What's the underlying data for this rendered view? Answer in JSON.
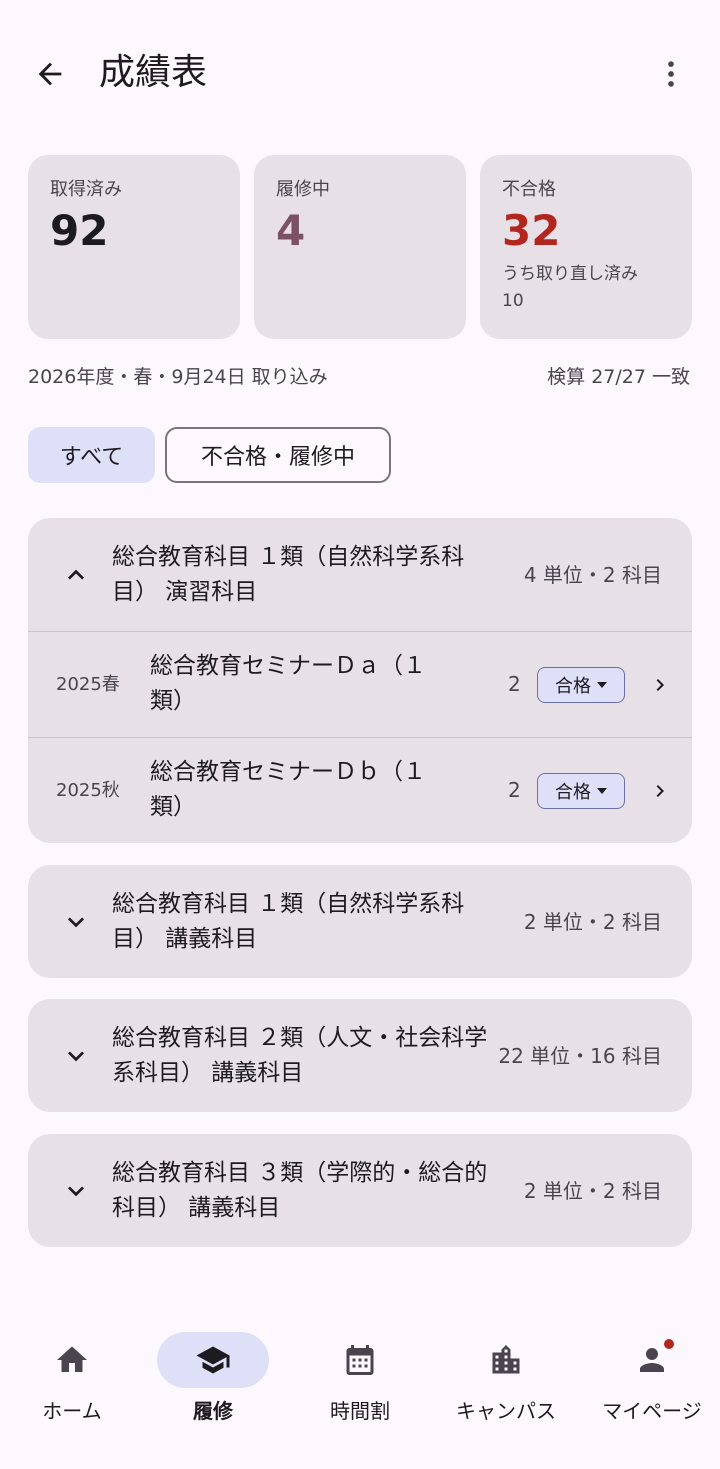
{
  "header": {
    "title": "成績表"
  },
  "summary": {
    "earned": {
      "label": "取得済み",
      "value": "92"
    },
    "in_progress": {
      "label": "履修中",
      "value": "4"
    },
    "failed": {
      "label": "不合格",
      "value": "32",
      "sub_label": "うち取り直し済み",
      "sub_value": "10"
    }
  },
  "meta": {
    "import_info": "2026年度・春・9月24日 取り込み",
    "check_info": "検算 27/27 一致"
  },
  "filters": [
    {
      "label": "すべて",
      "selected": true
    },
    {
      "label": "不合格・履修中",
      "selected": false
    }
  ],
  "groups": [
    {
      "title": "総合教育科目 １類（自然科学系科目） 演習科目",
      "count": "4 単位・2 科目",
      "expanded": true,
      "courses": [
        {
          "term": "2025春",
          "name": "総合教育セミナーＤａ（１類）",
          "credits": "2",
          "status": "合格"
        },
        {
          "term": "2025秋",
          "name": "総合教育セミナーＤｂ（１類）",
          "credits": "2",
          "status": "合格"
        }
      ]
    },
    {
      "title": "総合教育科目 １類（自然科学系科目） 講義科目",
      "count": "2 単位・2 科目",
      "expanded": false
    },
    {
      "title": "総合教育科目 ２類（人文・社会科学系科目） 講義科目",
      "count": "22 単位・16 科目",
      "expanded": false
    },
    {
      "title": "総合教育科目 ３類（学際的・総合的科目） 講義科目",
      "count": "2 単位・2 科目",
      "expanded": false
    }
  ],
  "bottom_nav": [
    {
      "label": "ホーム",
      "icon": "home-icon",
      "active": false
    },
    {
      "label": "履修",
      "icon": "school-icon",
      "active": true
    },
    {
      "label": "時間割",
      "icon": "calendar-icon",
      "active": false
    },
    {
      "label": "キャンパス",
      "icon": "building-icon",
      "active": false
    },
    {
      "label": "マイページ",
      "icon": "person-icon",
      "active": false,
      "badge": true
    }
  ],
  "colors": {
    "accent": "#dee0f8",
    "surface": "#e7e0e7",
    "error": "#b3261e",
    "in_progress": "#7c5262"
  }
}
